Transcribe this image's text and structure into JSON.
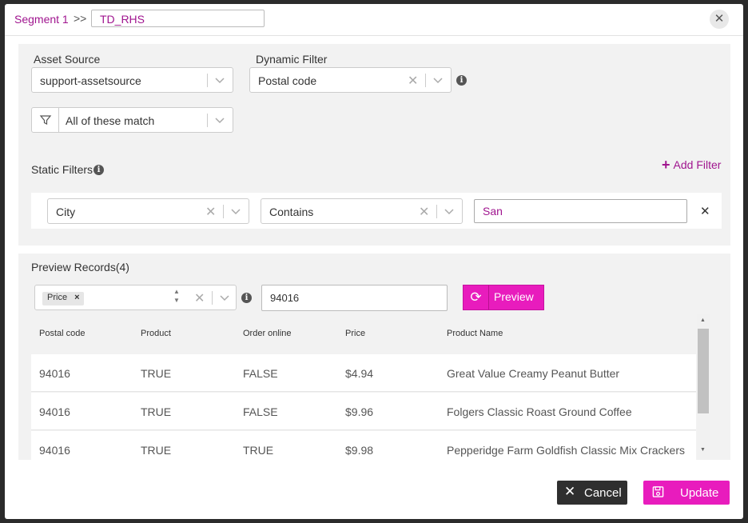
{
  "header": {
    "segment_label": "Segment 1",
    "arrows": ">>",
    "segment_name": "TD_RHS"
  },
  "asset_source": {
    "label": "Asset Source",
    "value": "support-assetsource"
  },
  "dynamic_filter": {
    "label": "Dynamic Filter",
    "value": "Postal code"
  },
  "match_select": {
    "value": "All of these match"
  },
  "static_filters": {
    "label": "Static Filters",
    "add_label": "Add Filter",
    "row": {
      "field": "City",
      "operator": "Contains",
      "value": "San"
    }
  },
  "preview": {
    "title": "Preview Records(4)",
    "chip_label": "Price",
    "value": "94016",
    "button_label": "Preview",
    "columns": [
      "Postal code",
      "Product",
      "Order online",
      "Price",
      "Product Name"
    ],
    "rows": [
      [
        "94016",
        "TRUE",
        "FALSE",
        "$4.94",
        "Great Value Creamy Peanut Butter"
      ],
      [
        "94016",
        "TRUE",
        "FALSE",
        "$9.96",
        "Folgers Classic Roast Ground Coffee"
      ],
      [
        "94016",
        "TRUE",
        "TRUE",
        "$9.98",
        "Pepperidge Farm Goldfish Classic Mix Crackers"
      ]
    ]
  },
  "footer": {
    "cancel_label": "Cancel",
    "update_label": "Update"
  },
  "colors": {
    "accent": "#e81cbd",
    "brand_text": "#a0158f",
    "panel_bg": "#f2f2f2",
    "dark_button": "#2f2f2f"
  },
  "icons": [
    "close-icon",
    "chevron-down-icon",
    "clear-icon",
    "info-icon",
    "filter-funnel-icon",
    "plus-icon",
    "refresh-icon",
    "save-icon"
  ]
}
